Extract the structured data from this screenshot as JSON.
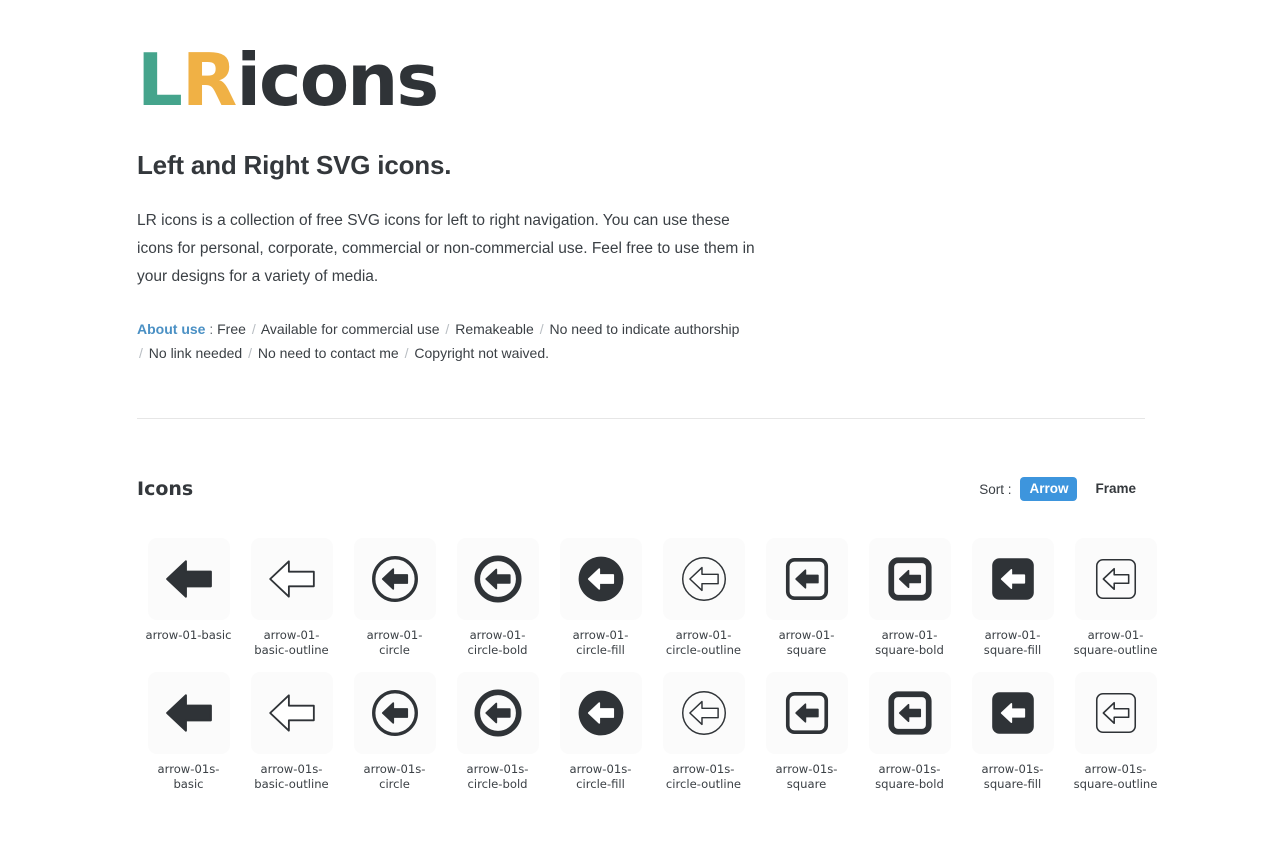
{
  "logo": {
    "l": "L",
    "r": "R",
    "rest": "icons"
  },
  "headline": "Left and Right SVG icons.",
  "description": "LR icons is a collection of free SVG icons for left to right navigation. You can use these icons for personal, corporate, commercial or non-commercial use. Feel free to use them in your designs for a variety of media.",
  "about": {
    "label": "About use",
    "colon": ":",
    "items": [
      "Free",
      "Available for commercial use",
      "Remakeable",
      "No need to indicate authorship",
      "No link needed",
      "No need to contact me",
      "Copyright not waived."
    ]
  },
  "section": {
    "title": "Icons",
    "sort_label": "Sort :",
    "sort_options": [
      {
        "label": "Arrow",
        "active": true
      },
      {
        "label": "Frame",
        "active": false
      }
    ],
    "accent_color": "#3d95dd"
  },
  "colors": {
    "logo_l": "#45a48c",
    "logo_r": "#f0b145",
    "logo_rest": "#2f3337",
    "icon_dark": "#2f3337",
    "card_bg": "#fbfbfb",
    "link_blue": "#4a90c4"
  },
  "icons": [
    {
      "label": "arrow-01-basic",
      "icon": "arrow-basic",
      "variant": "basic"
    },
    {
      "label": "arrow-01-basic-outline",
      "icon": "arrow-basic-outline",
      "variant": "basic-outline"
    },
    {
      "label": "arrow-01-circle",
      "icon": "arrow-circle",
      "variant": "circle"
    },
    {
      "label": "arrow-01-circle-bold",
      "icon": "arrow-circle-bold",
      "variant": "circle-bold"
    },
    {
      "label": "arrow-01-circle-fill",
      "icon": "arrow-circle-fill",
      "variant": "circle-fill"
    },
    {
      "label": "arrow-01-circle-outline",
      "icon": "arrow-circle-outline",
      "variant": "circle-outline"
    },
    {
      "label": "arrow-01-square",
      "icon": "arrow-square",
      "variant": "square"
    },
    {
      "label": "arrow-01-square-bold",
      "icon": "arrow-square-bold",
      "variant": "square-bold"
    },
    {
      "label": "arrow-01-square-fill",
      "icon": "arrow-square-fill",
      "variant": "square-fill"
    },
    {
      "label": "arrow-01-square-outline",
      "icon": "arrow-square-outline",
      "variant": "square-outline"
    },
    {
      "label": "arrow-01s-basic",
      "icon": "arrow-basic",
      "variant": "basic"
    },
    {
      "label": "arrow-01s-basic-outline",
      "icon": "arrow-basic-outline",
      "variant": "basic-outline"
    },
    {
      "label": "arrow-01s-circle",
      "icon": "arrow-circle",
      "variant": "circle"
    },
    {
      "label": "arrow-01s-circle-bold",
      "icon": "arrow-circle-bold",
      "variant": "circle-bold"
    },
    {
      "label": "arrow-01s-circle-fill",
      "icon": "arrow-circle-fill",
      "variant": "circle-fill"
    },
    {
      "label": "arrow-01s-circle-outline",
      "icon": "arrow-circle-outline",
      "variant": "circle-outline"
    },
    {
      "label": "arrow-01s-square",
      "icon": "arrow-square",
      "variant": "square"
    },
    {
      "label": "arrow-01s-square-bold",
      "icon": "arrow-square-bold",
      "variant": "square-bold"
    },
    {
      "label": "arrow-01s-square-fill",
      "icon": "arrow-square-fill",
      "variant": "square-fill"
    },
    {
      "label": "arrow-01s-square-outline",
      "icon": "arrow-square-outline",
      "variant": "square-outline"
    }
  ]
}
